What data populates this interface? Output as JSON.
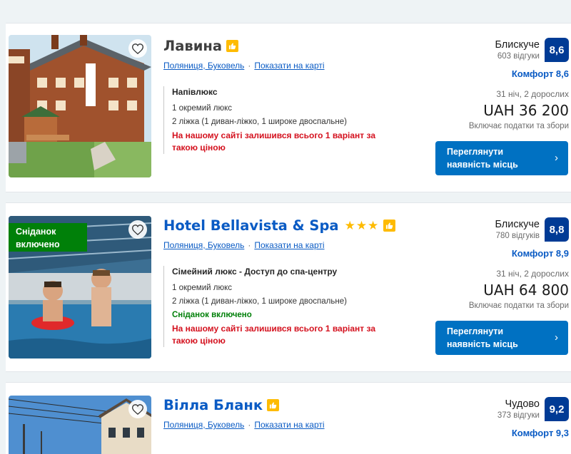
{
  "hotels": [
    {
      "name": "Лавина",
      "stars": "",
      "breakfast_badge": "",
      "location": "Поляниця, Буковель",
      "map_link": "Показати на карті",
      "room_type": "Напівлюкс",
      "room_units": "1 окремий люкс",
      "beds": "2 ліжка (1 диван-ліжко, 1 широке двоспальне)",
      "breakfast_note": "",
      "availability_warning": "На нашому сайті залишився всього 1 варіант за такою ціною",
      "rating_word": "Блискуче",
      "reviews": "603 відгуки",
      "score": "8,6",
      "comfort": "Комфорт 8,6",
      "stay": "31 ніч, 2 дорослих",
      "price": "UAH 36 200",
      "taxes": "Включає податки та збори",
      "cta_line1": "Переглянути",
      "cta_line2": "наявність місць"
    },
    {
      "name": "Hotel Bellavista & Spa",
      "stars": "★★★",
      "breakfast_badge_line1": "Сніданок",
      "breakfast_badge_line2": "включено",
      "location": "Поляниця, Буковель",
      "map_link": "Показати на карті",
      "room_type": "Сімейний люкс - Доступ до спа-центру",
      "room_units": "1 окремий люкс",
      "beds": "2 ліжка (1 диван-ліжко, 1 широке двоспальне)",
      "breakfast_note": "Сніданок включено",
      "availability_warning": "На нашому сайті залишився всього 1 варіант за такою ціною",
      "rating_word": "Блискуче",
      "reviews": "780 відгуків",
      "score": "8,8",
      "comfort": "Комфорт 8,9",
      "stay": "31 ніч, 2 дорослих",
      "price": "UAH 64 800",
      "taxes": "Включає податки та збори",
      "cta_line1": "Переглянути",
      "cta_line2": "наявність місць"
    },
    {
      "name": "Вілла Бланк",
      "location": "Поляниця, Буковель",
      "map_link": "Показати на карті",
      "rating_word": "Чудово",
      "reviews": "373 відгуки",
      "score": "9,2",
      "comfort": "Комфорт 9,3"
    }
  ],
  "colors": {
    "link_blue": "#0a5bc4",
    "score_navy": "#003b95",
    "cta_blue": "#0071c2",
    "warning_red": "#d4111e",
    "breakfast_green": "#008009",
    "star_yellow": "#febb02"
  },
  "icons": {
    "favorite": "heart-icon",
    "preferred_partner": "thumbs-up-icon",
    "cta_arrow": "chevron-right-icon"
  }
}
